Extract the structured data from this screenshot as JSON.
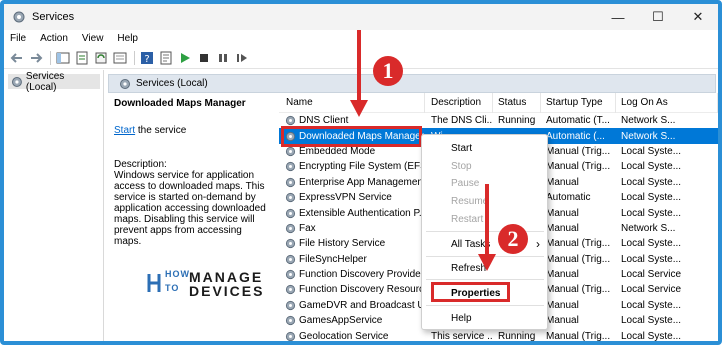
{
  "window": {
    "title": "Services",
    "minimize": "—",
    "maximize": "☐",
    "close": "✕"
  },
  "menu": [
    "File",
    "Action",
    "View",
    "Help"
  ],
  "toolbar": {
    "icons": [
      "back-arrow-icon",
      "forward-arrow-icon",
      "console-tree-icon",
      "refresh-icon",
      "export-list-icon",
      "help-icon",
      "properties-icon",
      "start-icon",
      "stop-icon",
      "pause-icon",
      "restart-icon"
    ]
  },
  "tree": {
    "item": "Services (Local)"
  },
  "pane_header": {
    "label": "Services (Local)"
  },
  "description_panel": {
    "service_name": "Downloaded Maps Manager",
    "start_link": "Start",
    "start_suffix": " the service",
    "desc_label": "Description:",
    "desc_text": "Windows service for application access to downloaded maps. This service is started on-demand by application accessing downloaded maps. Disabling this service will prevent apps from accessing maps."
  },
  "table": {
    "headers": {
      "name": "Name",
      "description": "Description",
      "status": "Status",
      "startup": "Startup Type",
      "logon": "Log On As"
    },
    "rows": [
      {
        "name": "DNS Client",
        "description": "The DNS Cli...",
        "status": "Running",
        "startup": "Automatic (T...",
        "logon": "Network S..."
      },
      {
        "name": "Downloaded Maps Manager",
        "description": "Wi...",
        "status": "",
        "startup": "Automatic (...",
        "logon": "Network S..."
      },
      {
        "name": "Embedded Mode",
        "description": "",
        "status": "",
        "startup": "Manual (Trig...",
        "logon": "Local Syste..."
      },
      {
        "name": "Encrypting File System (EFS)",
        "description": "",
        "status": "",
        "startup": "Manual (Trig...",
        "logon": "Local Syste..."
      },
      {
        "name": "Enterprise App Managemen...",
        "description": "",
        "status": "",
        "startup": "Manual",
        "logon": "Local Syste..."
      },
      {
        "name": "ExpressVPN Service",
        "description": "",
        "status": "",
        "startup": "Automatic",
        "logon": "Local Syste..."
      },
      {
        "name": "Extensible Authentication P...",
        "description": "",
        "status": "",
        "startup": "Manual",
        "logon": "Local Syste..."
      },
      {
        "name": "Fax",
        "description": "",
        "status": "",
        "startup": "Manual",
        "logon": "Network S..."
      },
      {
        "name": "File History Service",
        "description": "",
        "status": "",
        "startup": "Manual (Trig...",
        "logon": "Local Syste..."
      },
      {
        "name": "FileSyncHelper",
        "description": "",
        "status": "",
        "startup": "Manual (Trig...",
        "logon": "Local Syste..."
      },
      {
        "name": "Function Discovery Provide...",
        "description": "",
        "status": "",
        "startup": "Manual",
        "logon": "Local Service"
      },
      {
        "name": "Function Discovery Resourc...",
        "description": "",
        "status": "",
        "startup": "Manual (Trig...",
        "logon": "Local Service"
      },
      {
        "name": "GameDVR and Broadcast Us...",
        "description": "",
        "status": "",
        "startup": "Manual",
        "logon": "Local Syste..."
      },
      {
        "name": "GamesAppService",
        "description": "",
        "status": "",
        "startup": "Manual",
        "logon": "Local Syste..."
      },
      {
        "name": "Geolocation Service",
        "description": "This service ...",
        "status": "Running",
        "startup": "Manual (Trig...",
        "logon": "Local Syste..."
      }
    ]
  },
  "context_menu": {
    "start": "Start",
    "stop": "Stop",
    "pause": "Pause",
    "resume": "Resume",
    "restart": "Restart",
    "all_tasks": "All Tasks",
    "all_tasks_arrow": "›",
    "refresh": "Refresh",
    "properties": "Properties",
    "help": "Help"
  },
  "callouts": {
    "step1": "1",
    "step2": "2",
    "accent": "#d92a2a"
  },
  "watermark": {
    "how": "HOW",
    "to": "TO",
    "manage": "MANAGE",
    "devices": "DEVICES"
  },
  "colors": {
    "selection": "#0078d7",
    "frame": "#2b8fd6",
    "callout": "#d92a2a"
  }
}
